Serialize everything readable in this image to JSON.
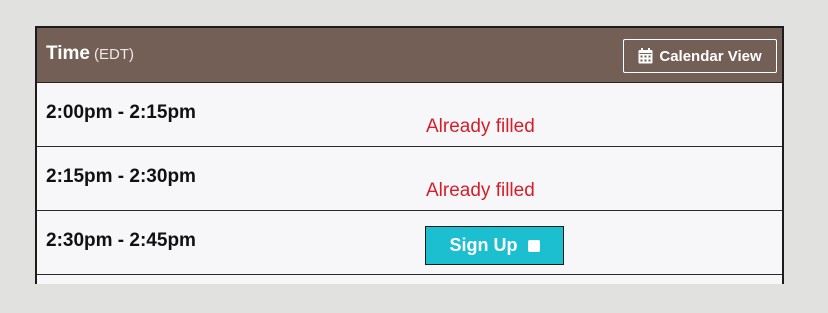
{
  "header": {
    "title": "Time",
    "timezone": "(EDT)",
    "calendar_button_label": "Calendar View",
    "calendar_icon": "calendar-icon"
  },
  "slots": [
    {
      "time": "2:00pm - 2:15pm",
      "status": "Already filled"
    },
    {
      "time": "2:15pm - 2:30pm",
      "status": "Already filled"
    },
    {
      "time": "2:30pm - 2:45pm",
      "action_label": "Sign Up",
      "action_icon": "checkbox-icon"
    }
  ],
  "colors": {
    "header_bg": "#735f55",
    "filled_text": "#d5202a",
    "signup_bg": "#1bbfd0",
    "page_bg": "#e1e2df"
  }
}
